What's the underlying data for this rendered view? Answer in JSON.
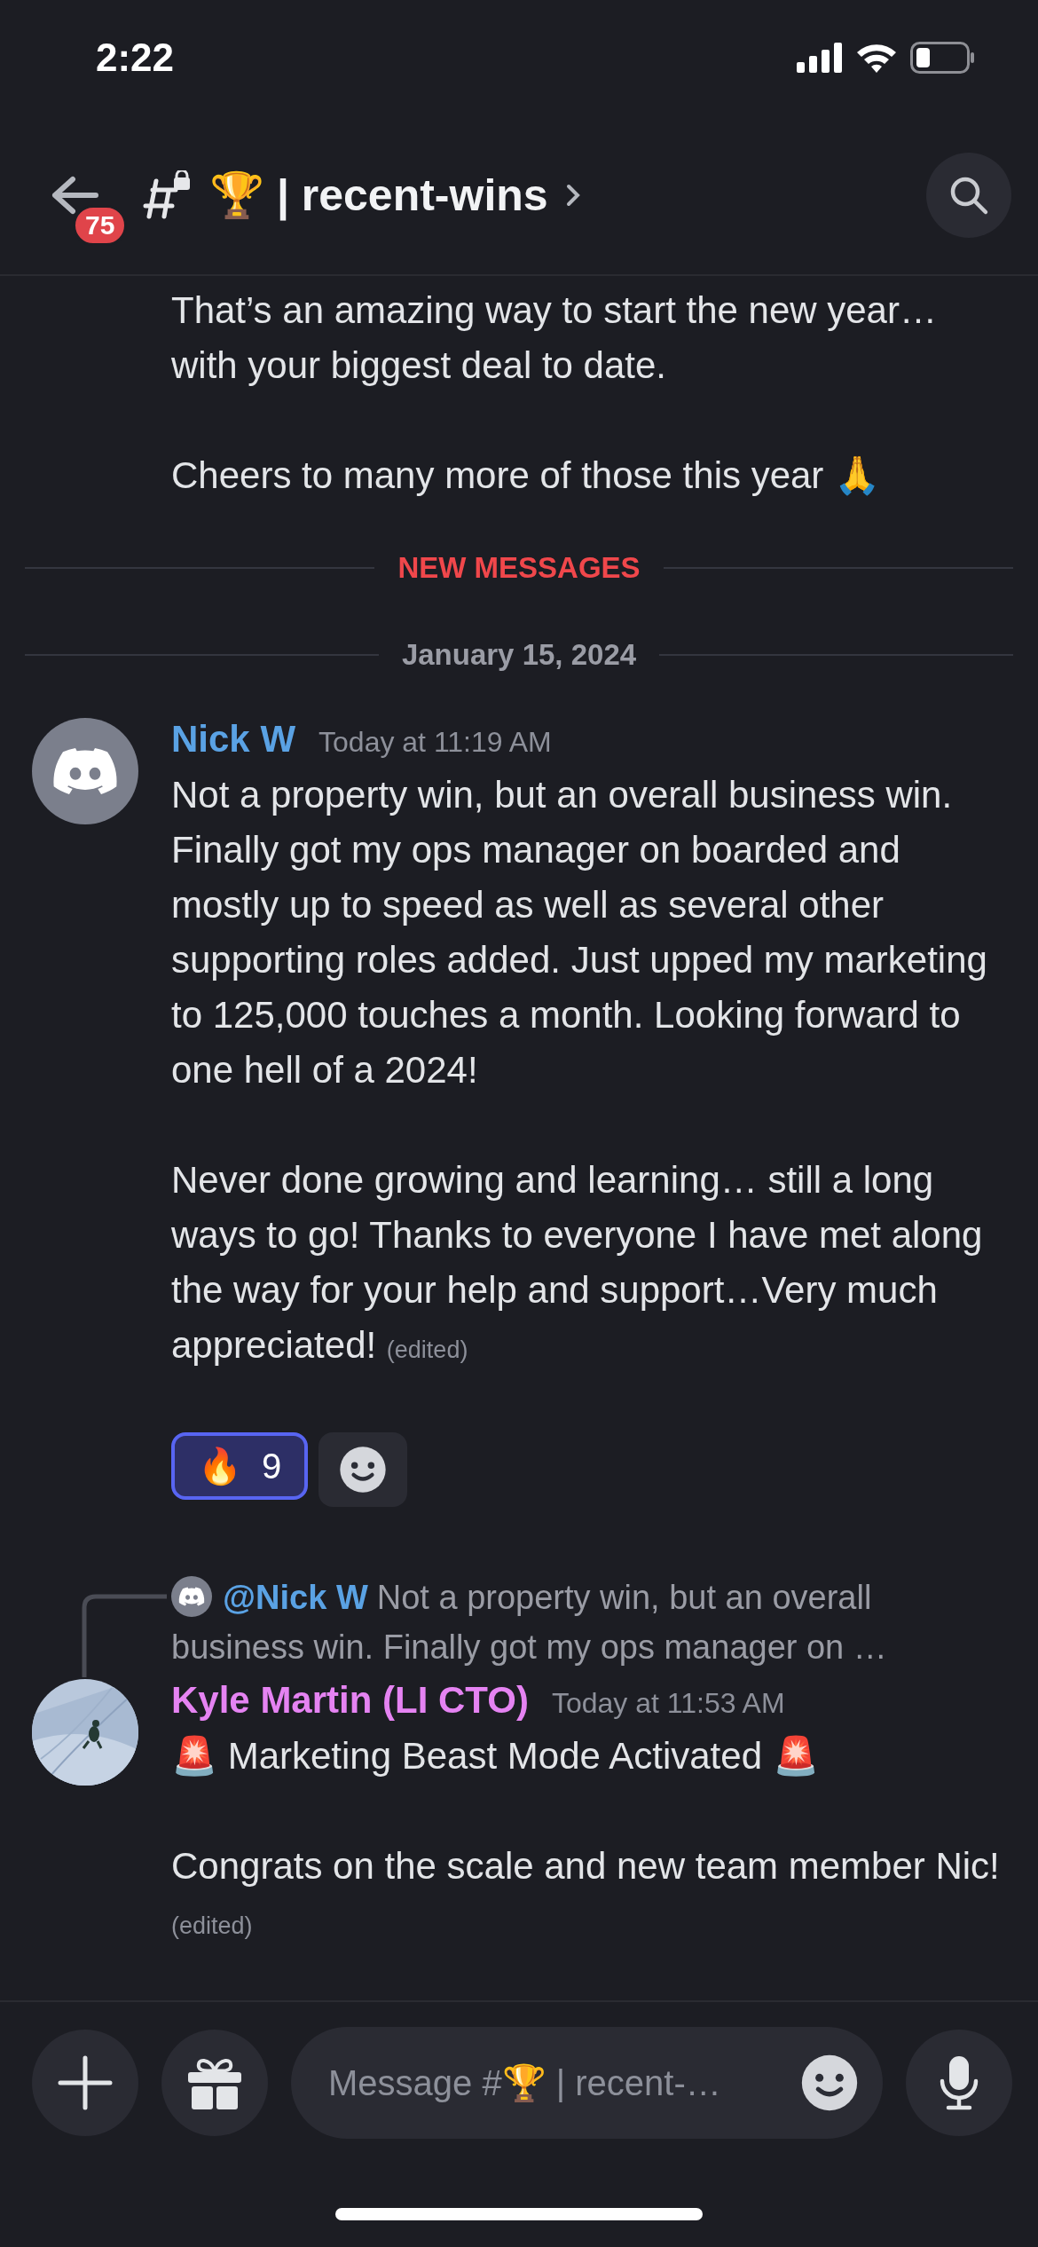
{
  "status_bar": {
    "time": "2:22"
  },
  "header": {
    "unread_count": "75",
    "channel_name": "🏆 | recent-wins"
  },
  "messages": [
    {
      "kind": "continuation",
      "paragraphs": [
        "That’s an amazing way to start the new year… with your biggest deal to date.",
        "Cheers to many more of those this year 🙏"
      ]
    },
    {
      "kind": "new_divider",
      "label": "NEW MESSAGES"
    },
    {
      "kind": "date_divider",
      "label": "January 15, 2024"
    },
    {
      "kind": "message",
      "author": "Nick W",
      "color": "#5aa2e4",
      "timestamp": "Today at 11:19 AM",
      "avatar": {
        "kind": "default"
      },
      "paragraphs": [
        "Not a property win, but an overall business win. Finally got my ops manager on boarded and mostly up to speed as well as several other supporting roles added. Just upped my marketing to 125,000 touches a month. Looking forward to one hell of a 2024!",
        "Never done growing and learning… still a long ways to go!  Thanks to everyone I have met along the way for your help and support…Very much appreciated!"
      ],
      "edited": "(edited)",
      "reactions": [
        {
          "emoji": "🔥",
          "count": "9",
          "selected": true
        }
      ]
    },
    {
      "kind": "message",
      "author": "Kyle Martin (LI CTO)",
      "color": "#e583f2",
      "timestamp": "Today at 11:53 AM",
      "reply": {
        "mention": "@Nick W",
        "excerpt": "Not a property win, but an overall business win. Finally got my ops manager on …"
      },
      "paragraphs": [
        "🚨 Marketing Beast Mode Activated 🚨",
        "Congrats on the scale and new team member Nic!"
      ],
      "edited": "(edited)"
    }
  ],
  "composer": {
    "placeholder": "Message #🏆 | recent-…"
  }
}
